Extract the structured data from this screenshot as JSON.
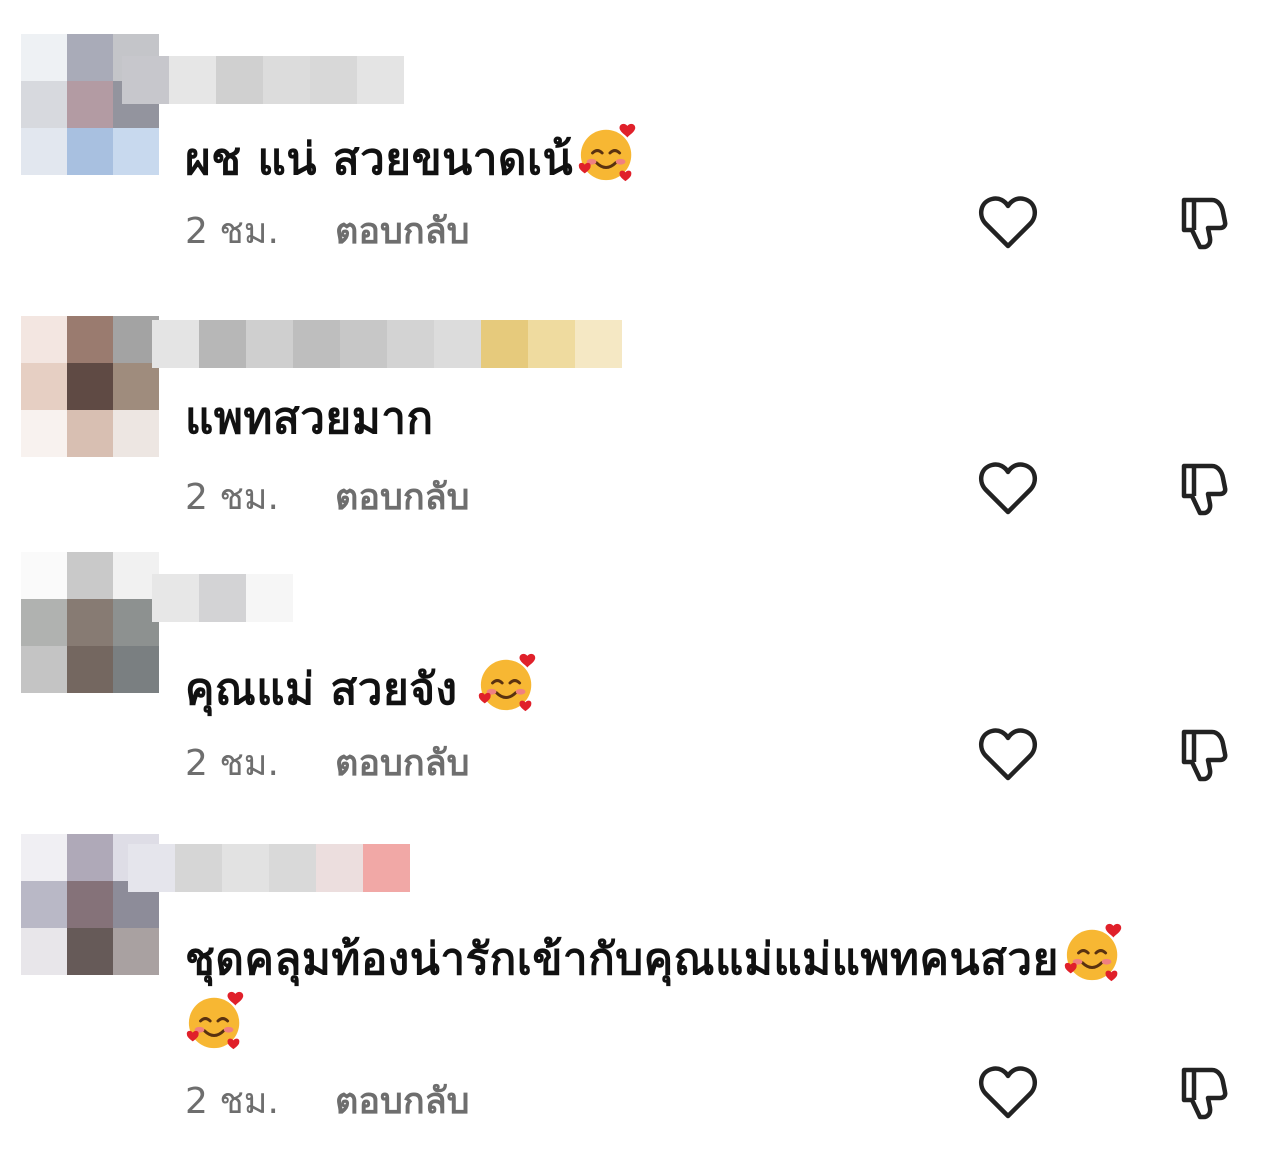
{
  "comments": [
    {
      "text": "ผช แน่ สวยขนาดเน้",
      "emoji_after": true,
      "time": "2 ชม.",
      "reply_label": "ตอบกลับ",
      "like_icon": "heart-outline-icon",
      "dislike_icon": "thumbs-down-icon"
    },
    {
      "text": "แพทสวยมาก",
      "emoji_after": false,
      "time": "2 ชม.",
      "reply_label": "ตอบกลับ",
      "like_icon": "heart-outline-icon",
      "dislike_icon": "thumbs-down-icon"
    },
    {
      "text": "คุณแม่ สวยจัง",
      "emoji_after": true,
      "time": "2 ชม.",
      "reply_label": "ตอบกลับ",
      "like_icon": "heart-outline-icon",
      "dislike_icon": "thumbs-down-icon"
    },
    {
      "text": "ชุดคลุมท้องน่ารักเข้ากับคุณแม่แม่แพทคนสวย",
      "emoji_after": true,
      "emoji_second_line": true,
      "time": "2 ชม.",
      "reply_label": "ตอบกลับ",
      "like_icon": "heart-outline-icon",
      "dislike_icon": "thumbs-down-icon"
    }
  ],
  "colors": {
    "text": "#111111",
    "meta": "#6e6e6e",
    "icon": "#222222",
    "background": "#ffffff"
  },
  "emoji": "smiling-face-with-hearts-icon"
}
